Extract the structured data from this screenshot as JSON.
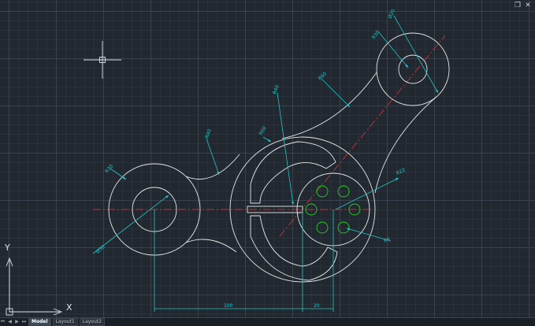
{
  "window": {
    "restore_icon": "restore-icon",
    "close_icon": "close-icon"
  },
  "tabs": {
    "model": "Model",
    "layout1": "Layout1",
    "layout2": "Layout2"
  },
  "axes": {
    "x_label": "X",
    "y_label": "Y"
  },
  "dimensions": {
    "r40_top": "R40",
    "r40_left": "R40",
    "r60_mid": "R60",
    "r60_top": "R60",
    "r30_left": "R30",
    "r30_top": "R30",
    "d30_left": "Ø30",
    "d20_top": "Ø20",
    "r22": "R22",
    "r4": "R4",
    "len_100": "100",
    "len_20": "20"
  },
  "colors": {
    "background": "#212830",
    "geometry": "#e8e8e8",
    "dimension": "#21c7c7",
    "centerline": "#d83a3a",
    "holes": "#1fd11f"
  }
}
